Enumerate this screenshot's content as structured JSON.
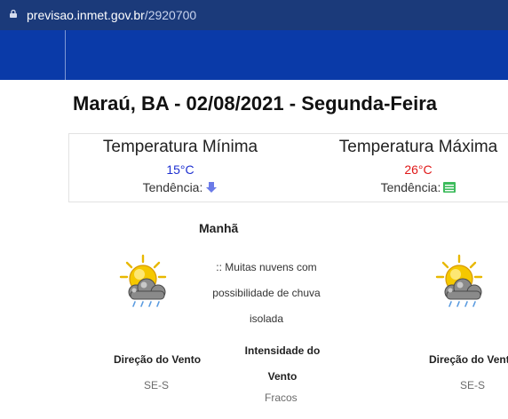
{
  "browser": {
    "url_domain": "previsao.inmet.gov.br",
    "url_path": "/2920700"
  },
  "page": {
    "title": "Maraú, BA - 02/08/2021 - Segunda-Feira"
  },
  "temperature": {
    "min": {
      "label": "Temperatura Mínima",
      "value": "15°C",
      "trend_label": "Tendência:",
      "trend_icon": "arrow-down-icon",
      "color": "#1d2fd0"
    },
    "max": {
      "label": "Temperatura Máxima",
      "value": "26°C",
      "trend_label": "Tendência:",
      "trend_icon": "stable-bars-icon",
      "color": "#e01818"
    }
  },
  "forecast": {
    "period": "Manhã",
    "icon": "sun-cloud-rain-icon",
    "description_lines": [
      ":: Muitas nuvens com",
      "possibilidade de chuva",
      "isolada"
    ],
    "wind_direction_label": "Direção do Vento",
    "wind_direction_value": "SE-S",
    "wind_intensity_label": "Intensidade do Vento",
    "wind_intensity_value": "Fracos",
    "right_wind_direction_label": "Direção do Vento",
    "right_wind_direction_value": "SE-S"
  },
  "colors": {
    "address_bar": "#1b3a7a",
    "site_header": "#0a3aa8"
  }
}
